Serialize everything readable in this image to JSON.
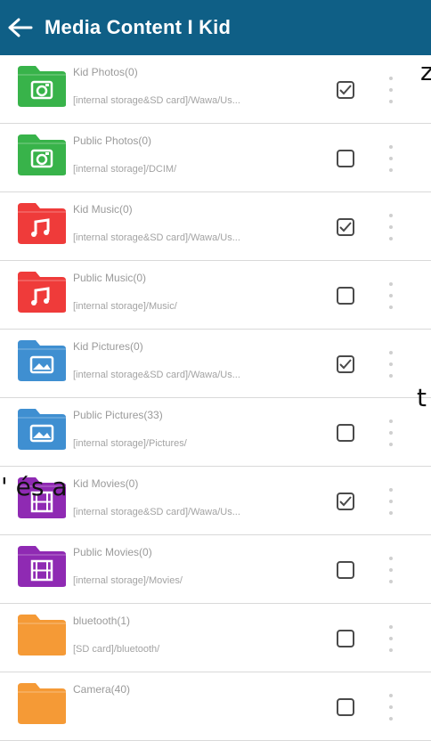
{
  "header": {
    "title": "Media Content I Kid"
  },
  "colors": {
    "header_bg": "#0f5f86",
    "folder_green": "#38b34a",
    "folder_red": "#ef3b3a",
    "folder_blue": "#3f8fd1",
    "folder_purple": "#8f2ab3",
    "folder_orange": "#f59a36"
  },
  "items": [
    {
      "name": "Kid Photos(0)",
      "path": "[internal storage&SD card]/Wawa/Us...",
      "icon": "photo-icon",
      "color": "green",
      "checked": true
    },
    {
      "name": "Public Photos(0)",
      "path": "[internal storage]/DCIM/",
      "icon": "photo-icon",
      "color": "green",
      "checked": false
    },
    {
      "name": "Kid Music(0)",
      "path": "[internal storage&SD card]/Wawa/Us...",
      "icon": "music-icon",
      "color": "red",
      "checked": true
    },
    {
      "name": "Public Music(0)",
      "path": "[internal storage]/Music/",
      "icon": "music-icon",
      "color": "red",
      "checked": false
    },
    {
      "name": "Kid Pictures(0)",
      "path": "[internal storage&SD card]/Wawa/Us...",
      "icon": "picture-icon",
      "color": "blue",
      "checked": true
    },
    {
      "name": "Public Pictures(33)",
      "path": "[internal storage]/Pictures/",
      "icon": "picture-icon",
      "color": "blue",
      "checked": false
    },
    {
      "name": "Kid Movies(0)",
      "path": "[internal storage&SD card]/Wawa/Us...",
      "icon": "movie-icon",
      "color": "purple",
      "checked": true
    },
    {
      "name": "Public Movies(0)",
      "path": "[internal storage]/Movies/",
      "icon": "movie-icon",
      "color": "purple",
      "checked": false
    },
    {
      "name": "bluetooth(1)",
      "path": "[SD card]/bluetooth/",
      "icon": "folder-icon",
      "color": "orange",
      "checked": false
    },
    {
      "name": "Camera(40)",
      "path": "",
      "icon": "folder-icon",
      "color": "orange",
      "checked": false
    }
  ],
  "overlay_text": {
    "z": "z",
    "t": "t",
    "es_a": "' és a"
  }
}
